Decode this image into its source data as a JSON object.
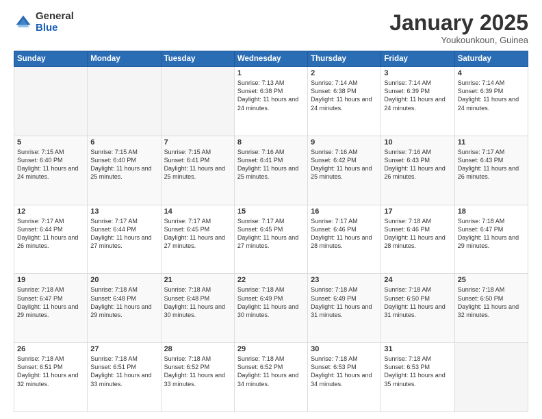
{
  "header": {
    "logo_general": "General",
    "logo_blue": "Blue",
    "month_title": "January 2025",
    "location": "Youkounkoun, Guinea"
  },
  "days_of_week": [
    "Sunday",
    "Monday",
    "Tuesday",
    "Wednesday",
    "Thursday",
    "Friday",
    "Saturday"
  ],
  "weeks": [
    [
      {
        "day": "",
        "detail": ""
      },
      {
        "day": "",
        "detail": ""
      },
      {
        "day": "",
        "detail": ""
      },
      {
        "day": "1",
        "detail": "Sunrise: 7:13 AM\nSunset: 6:38 PM\nDaylight: 11 hours and 24 minutes."
      },
      {
        "day": "2",
        "detail": "Sunrise: 7:14 AM\nSunset: 6:38 PM\nDaylight: 11 hours and 24 minutes."
      },
      {
        "day": "3",
        "detail": "Sunrise: 7:14 AM\nSunset: 6:39 PM\nDaylight: 11 hours and 24 minutes."
      },
      {
        "day": "4",
        "detail": "Sunrise: 7:14 AM\nSunset: 6:39 PM\nDaylight: 11 hours and 24 minutes."
      }
    ],
    [
      {
        "day": "5",
        "detail": "Sunrise: 7:15 AM\nSunset: 6:40 PM\nDaylight: 11 hours and 24 minutes."
      },
      {
        "day": "6",
        "detail": "Sunrise: 7:15 AM\nSunset: 6:40 PM\nDaylight: 11 hours and 25 minutes."
      },
      {
        "day": "7",
        "detail": "Sunrise: 7:15 AM\nSunset: 6:41 PM\nDaylight: 11 hours and 25 minutes."
      },
      {
        "day": "8",
        "detail": "Sunrise: 7:16 AM\nSunset: 6:41 PM\nDaylight: 11 hours and 25 minutes."
      },
      {
        "day": "9",
        "detail": "Sunrise: 7:16 AM\nSunset: 6:42 PM\nDaylight: 11 hours and 25 minutes."
      },
      {
        "day": "10",
        "detail": "Sunrise: 7:16 AM\nSunset: 6:43 PM\nDaylight: 11 hours and 26 minutes."
      },
      {
        "day": "11",
        "detail": "Sunrise: 7:17 AM\nSunset: 6:43 PM\nDaylight: 11 hours and 26 minutes."
      }
    ],
    [
      {
        "day": "12",
        "detail": "Sunrise: 7:17 AM\nSunset: 6:44 PM\nDaylight: 11 hours and 26 minutes."
      },
      {
        "day": "13",
        "detail": "Sunrise: 7:17 AM\nSunset: 6:44 PM\nDaylight: 11 hours and 27 minutes."
      },
      {
        "day": "14",
        "detail": "Sunrise: 7:17 AM\nSunset: 6:45 PM\nDaylight: 11 hours and 27 minutes."
      },
      {
        "day": "15",
        "detail": "Sunrise: 7:17 AM\nSunset: 6:45 PM\nDaylight: 11 hours and 27 minutes."
      },
      {
        "day": "16",
        "detail": "Sunrise: 7:17 AM\nSunset: 6:46 PM\nDaylight: 11 hours and 28 minutes."
      },
      {
        "day": "17",
        "detail": "Sunrise: 7:18 AM\nSunset: 6:46 PM\nDaylight: 11 hours and 28 minutes."
      },
      {
        "day": "18",
        "detail": "Sunrise: 7:18 AM\nSunset: 6:47 PM\nDaylight: 11 hours and 29 minutes."
      }
    ],
    [
      {
        "day": "19",
        "detail": "Sunrise: 7:18 AM\nSunset: 6:47 PM\nDaylight: 11 hours and 29 minutes."
      },
      {
        "day": "20",
        "detail": "Sunrise: 7:18 AM\nSunset: 6:48 PM\nDaylight: 11 hours and 29 minutes."
      },
      {
        "day": "21",
        "detail": "Sunrise: 7:18 AM\nSunset: 6:48 PM\nDaylight: 11 hours and 30 minutes."
      },
      {
        "day": "22",
        "detail": "Sunrise: 7:18 AM\nSunset: 6:49 PM\nDaylight: 11 hours and 30 minutes."
      },
      {
        "day": "23",
        "detail": "Sunrise: 7:18 AM\nSunset: 6:49 PM\nDaylight: 11 hours and 31 minutes."
      },
      {
        "day": "24",
        "detail": "Sunrise: 7:18 AM\nSunset: 6:50 PM\nDaylight: 11 hours and 31 minutes."
      },
      {
        "day": "25",
        "detail": "Sunrise: 7:18 AM\nSunset: 6:50 PM\nDaylight: 11 hours and 32 minutes."
      }
    ],
    [
      {
        "day": "26",
        "detail": "Sunrise: 7:18 AM\nSunset: 6:51 PM\nDaylight: 11 hours and 32 minutes."
      },
      {
        "day": "27",
        "detail": "Sunrise: 7:18 AM\nSunset: 6:51 PM\nDaylight: 11 hours and 33 minutes."
      },
      {
        "day": "28",
        "detail": "Sunrise: 7:18 AM\nSunset: 6:52 PM\nDaylight: 11 hours and 33 minutes."
      },
      {
        "day": "29",
        "detail": "Sunrise: 7:18 AM\nSunset: 6:52 PM\nDaylight: 11 hours and 34 minutes."
      },
      {
        "day": "30",
        "detail": "Sunrise: 7:18 AM\nSunset: 6:53 PM\nDaylight: 11 hours and 34 minutes."
      },
      {
        "day": "31",
        "detail": "Sunrise: 7:18 AM\nSunset: 6:53 PM\nDaylight: 11 hours and 35 minutes."
      },
      {
        "day": "",
        "detail": ""
      }
    ]
  ]
}
